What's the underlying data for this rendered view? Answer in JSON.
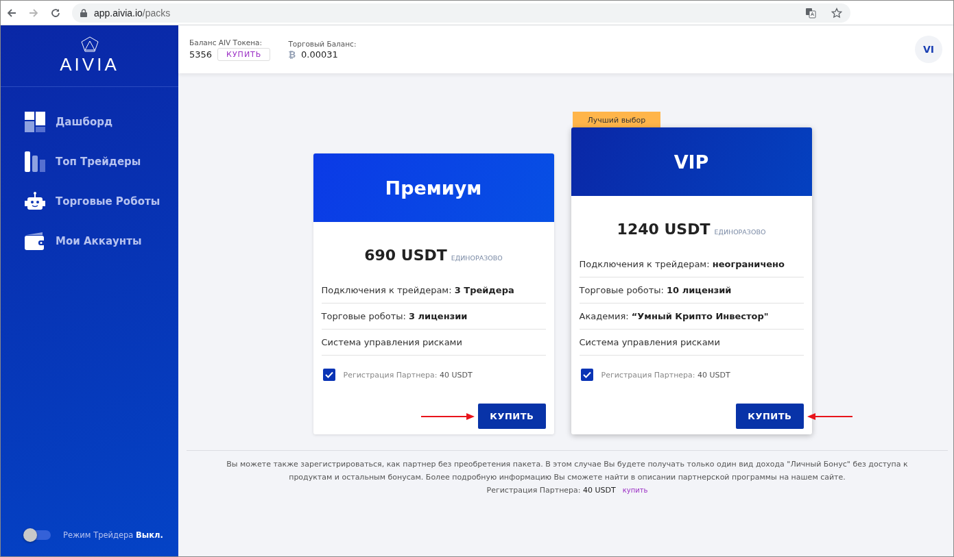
{
  "browser": {
    "url_host": "app.aivia.io",
    "url_path": "/packs"
  },
  "sidebar": {
    "logo": "AIVIA",
    "items": [
      {
        "label": "Дашборд",
        "selected": false
      },
      {
        "label": "Топ Трейдеры",
        "selected": false
      },
      {
        "label": "Торговые Роботы",
        "selected": false
      },
      {
        "label": "Мои Аккаунты",
        "selected": false
      }
    ],
    "trader_mode": {
      "label": "Режим Трейдера",
      "value": "Выкл.",
      "on": false
    }
  },
  "header": {
    "token_label": "Баланс AIV Токена:",
    "token_value": "5356",
    "buy": "КУПИТЬ",
    "trade_label": "Торговый Баланс:",
    "trade_symbol": "₿",
    "trade_value": "0.00031",
    "avatar": "VI"
  },
  "plans": [
    {
      "title": "Премиум",
      "price": "690 USDT",
      "period": "ЕДИНОРАЗОВО",
      "features": [
        "Подключения к трейдерам: **3 Трейдера**",
        "Торговые роботы: **3 лицензии**",
        "Система управления рисками"
      ],
      "partner": {
        "label": "Регистрация Партнера:",
        "value": "40 USDT",
        "checked": true
      },
      "button": "КУПИТЬ"
    },
    {
      "title": "VIP",
      "badge": "Лучший выбор",
      "price": "1240 USDT",
      "period": "ЕДИНОРАЗОВО",
      "features": [
        "Подключения к трейдерам: **неограничено**",
        "Торговые роботы: **10 лицензий**",
        "Академия: **“Умный Крипто Инвестор\"**",
        "Система управления рисками"
      ],
      "partner": {
        "label": "Регистрация Партнера:",
        "value": "40 USDT",
        "checked": true
      },
      "button": "КУПИТЬ"
    }
  ],
  "note": {
    "text": "Вы можете также зарегистрироваться, как партнер без преобретения пакета. В этом случае Вы будете получать только один вид дохода \"Личный Бонус\" без доступа к продуктам и остальным бонусам. Более подробную информацию Вы сможете найти в описании партнерской программы на нашем сайте.",
    "reg_label": "Регистрация Партнера:",
    "reg_value": "40 USDT",
    "link": "купить"
  }
}
